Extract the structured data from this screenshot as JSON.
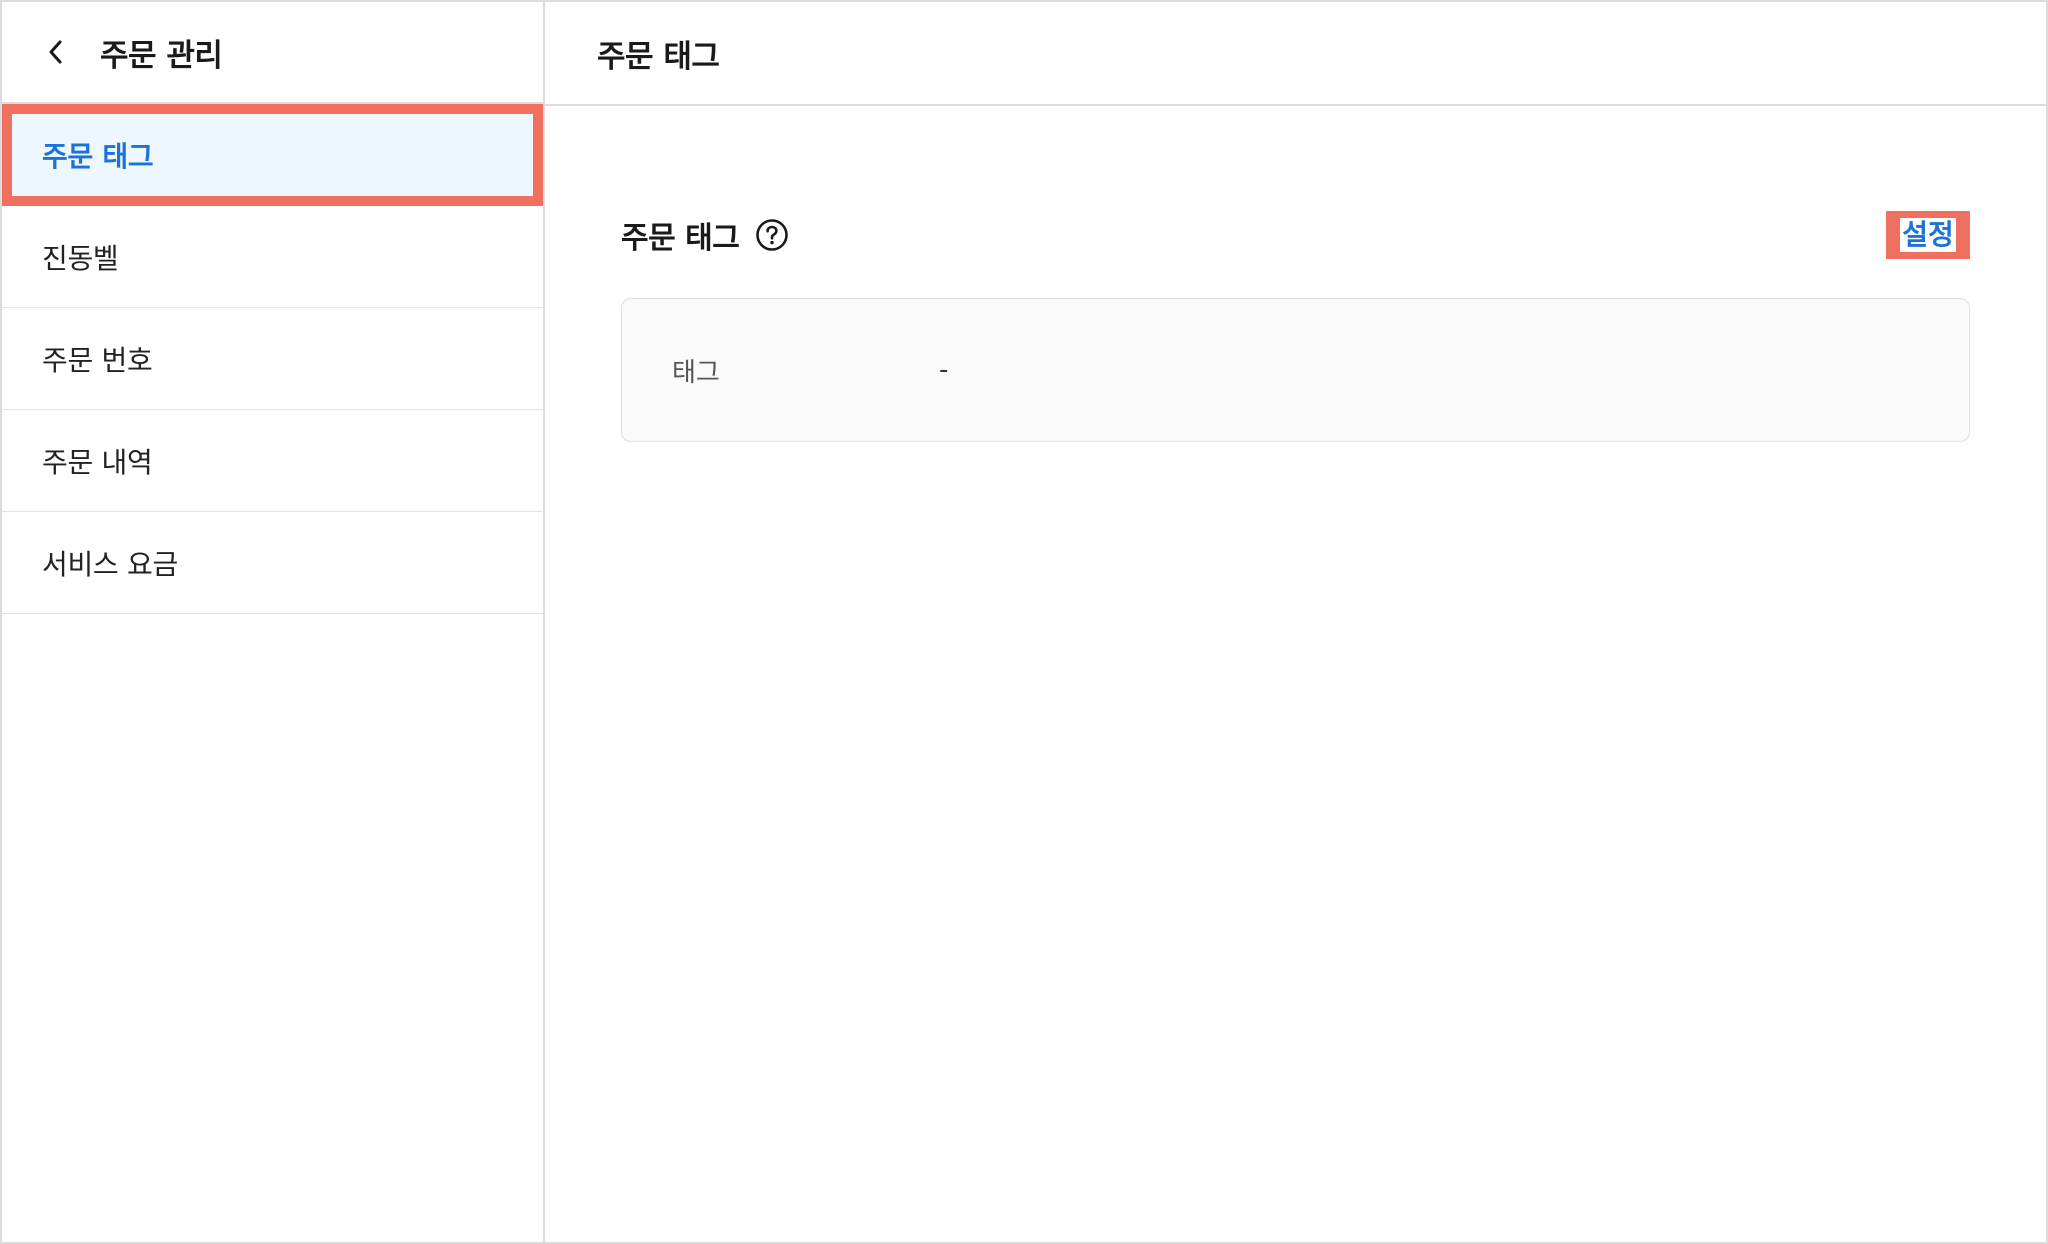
{
  "sidebar": {
    "title": "주문 관리",
    "back_icon": "chevron-left-icon",
    "items": [
      {
        "label": "주문 태그",
        "active": true
      },
      {
        "label": "진동벨",
        "active": false
      },
      {
        "label": "주문 번호",
        "active": false
      },
      {
        "label": "주문 내역",
        "active": false
      },
      {
        "label": "서비스 요금",
        "active": false
      }
    ]
  },
  "main": {
    "header_title": "주문 태그",
    "section_title": "주문 태그",
    "help_icon": "question-circle-icon",
    "setting_label": "설정",
    "tag_row": {
      "label": "태그",
      "value": "-"
    }
  },
  "colors": {
    "accent_blue": "#1a73d9",
    "active_bg": "#eef6fe",
    "highlight_red": "#f07060",
    "border_gray": "#dcdcdc"
  }
}
